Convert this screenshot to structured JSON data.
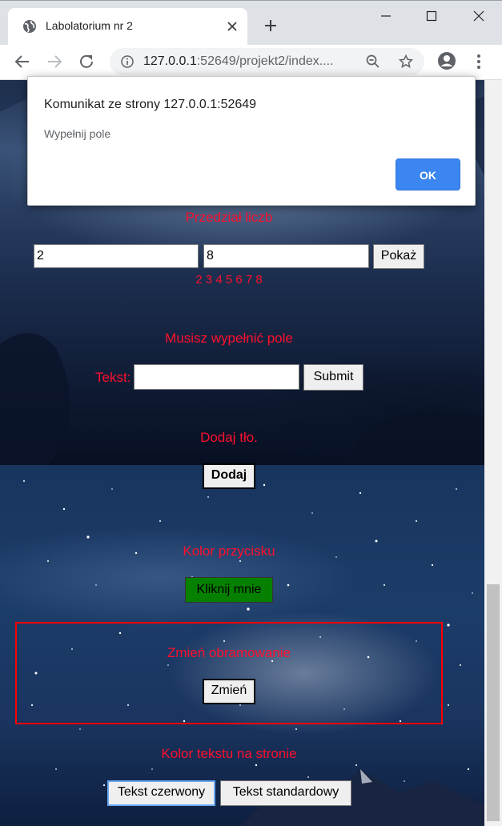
{
  "browser": {
    "tab_title": "Labolatorium nr 2",
    "url_host": "127.0.0.1",
    "url_rest": ":52649/projekt2/index...."
  },
  "dialog": {
    "title": "Komunikat ze strony 127.0.0.1:52649",
    "message": "Wypełnij pole",
    "ok_label": "OK"
  },
  "range_section": {
    "heading": "Przedział liczb",
    "from_value": "2",
    "to_value": "8",
    "show_label": "Pokaż",
    "result": "2 3 4 5 6 7 8"
  },
  "required_section": {
    "heading": "Musisz wypełnić pole",
    "text_label": "Tekst:",
    "text_value": "",
    "submit_label": "Submit"
  },
  "background_section": {
    "heading": "Dodaj tło.",
    "add_label": "Dodaj"
  },
  "button_color_section": {
    "heading": "Kolor przycisku",
    "click_label": "Kliknij mnie",
    "button_color": "#068001"
  },
  "border_section": {
    "heading": "Zmień obramowanie",
    "change_label": "Zmień",
    "border_color": "#ff0000"
  },
  "text_color_section": {
    "heading": "Kolor tekstu na stronie",
    "red_label": "Tekst czerwony",
    "standard_label": "Tekst standardowy",
    "text_color": "#ff0f2d"
  }
}
